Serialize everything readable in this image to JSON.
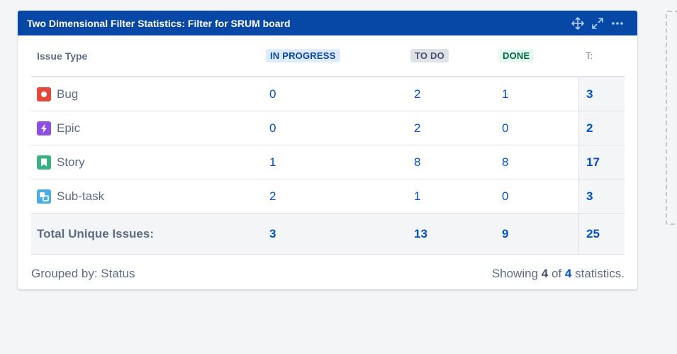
{
  "gadget": {
    "title": "Two Dimensional Filter Statistics: Filter for SRUM board",
    "icons": [
      "move-icon",
      "expand-icon",
      "more-icon"
    ]
  },
  "columns": {
    "issue_type": "Issue Type",
    "in_progress": "IN PROGRESS",
    "to_do": "TO DO",
    "done": "DONE",
    "total": "T:"
  },
  "rows": [
    {
      "type": "Bug",
      "icon": "bug-icon",
      "color": "#e5493a",
      "in_progress": "0",
      "to_do": "2",
      "done": "1",
      "total": "3"
    },
    {
      "type": "Epic",
      "icon": "epic-icon",
      "color": "#904ee2",
      "in_progress": "0",
      "to_do": "2",
      "done": "0",
      "total": "2"
    },
    {
      "type": "Story",
      "icon": "story-icon",
      "color": "#36b37e",
      "in_progress": "1",
      "to_do": "8",
      "done": "8",
      "total": "17"
    },
    {
      "type": "Sub-task",
      "icon": "subtask-icon",
      "color": "#4bade8",
      "in_progress": "2",
      "to_do": "1",
      "done": "0",
      "total": "3"
    }
  ],
  "totals": {
    "label": "Total Unique Issues:",
    "in_progress": "3",
    "to_do": "13",
    "done": "9",
    "total": "25"
  },
  "footer": {
    "grouped_by": "Grouped by: Status",
    "showing_prefix": "Showing",
    "showing_count": "4",
    "showing_of": "of",
    "showing_total": "4",
    "showing_suffix": "statistics."
  },
  "colors": {
    "header_bg": "#0747a6",
    "link": "#0052cc"
  }
}
